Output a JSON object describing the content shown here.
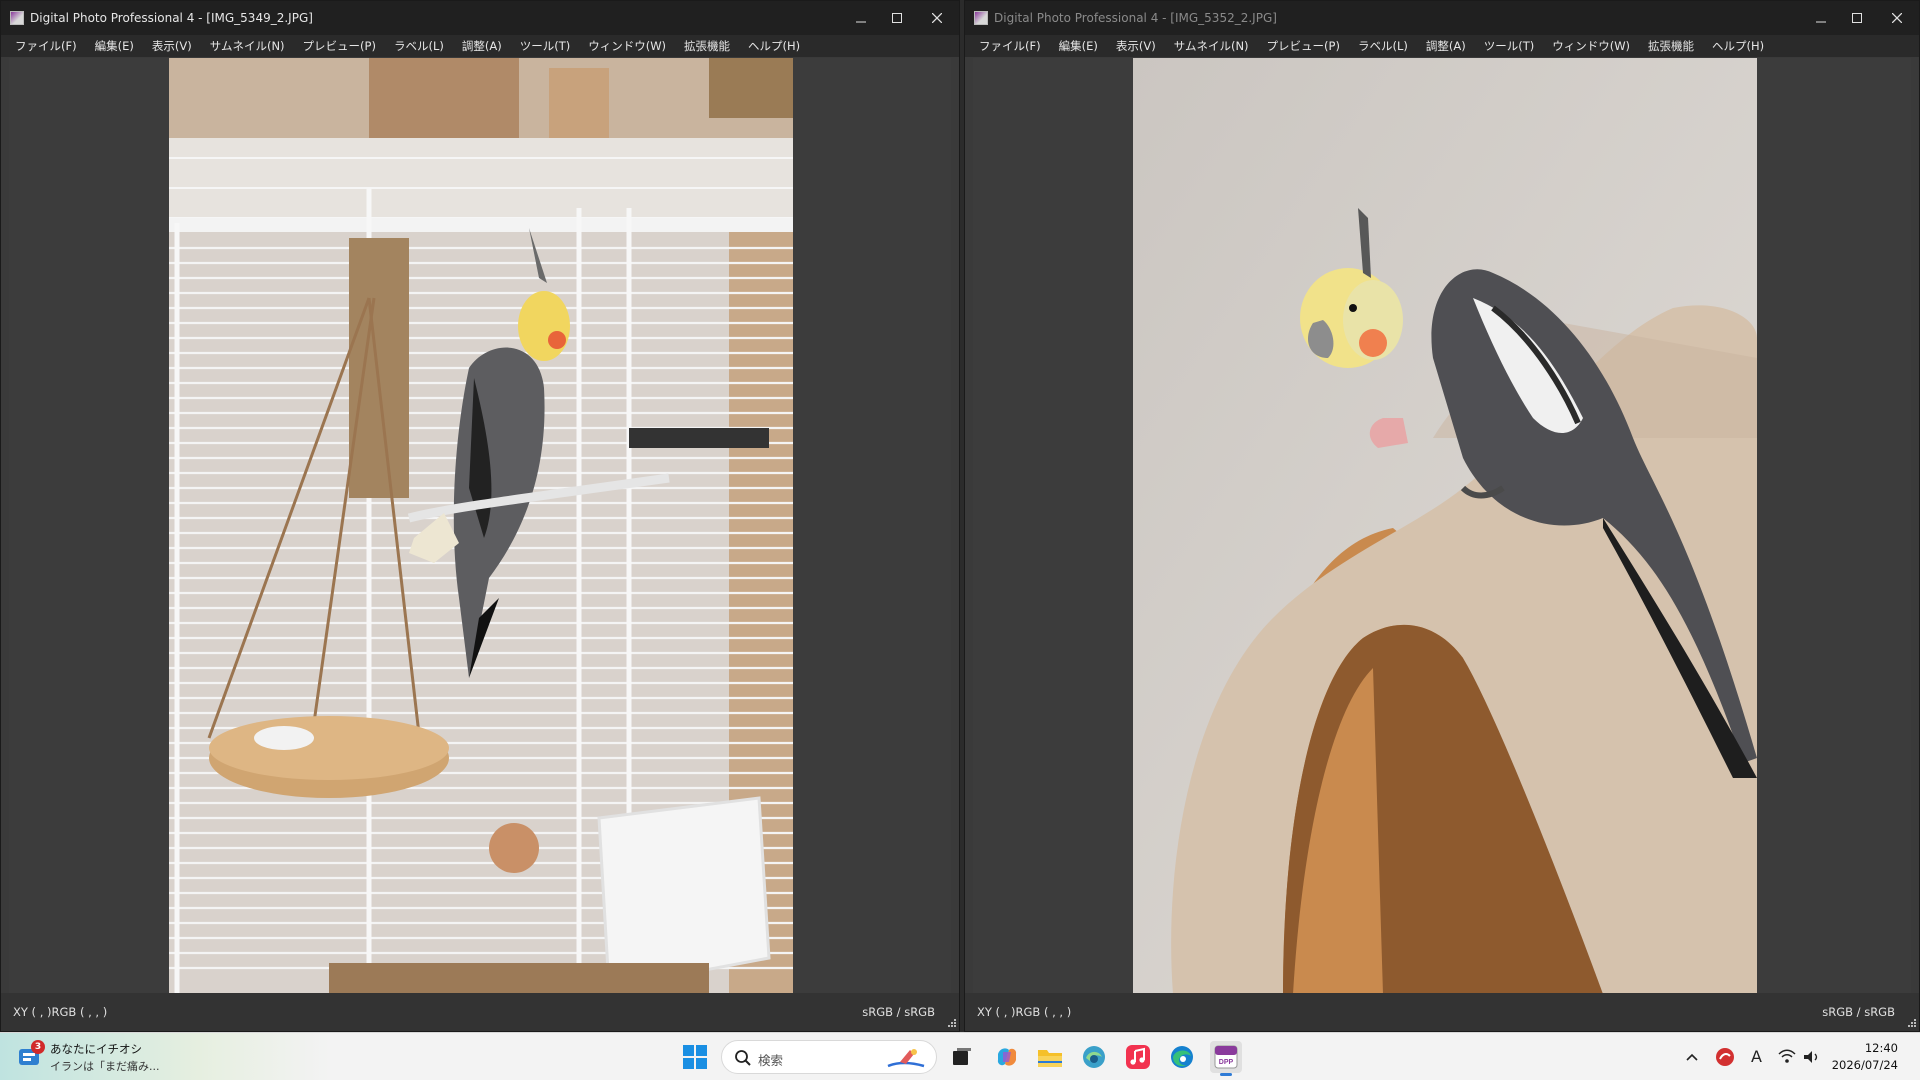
{
  "windows": [
    {
      "title": "Digital Photo Professional 4 - [IMG_5349_2.JPG]",
      "menu": [
        "ファイル(F)",
        "編集(E)",
        "表示(V)",
        "サムネイル(N)",
        "プレビュー(P)",
        "ラベル(L)",
        "調整(A)",
        "ツール(T)",
        "ウィンドウ(W)",
        "拡張機能",
        "ヘルプ(H)"
      ],
      "status_left": "XY (    ,    )RGB (    ,    ,    )",
      "status_right": "sRGB / sRGB"
    },
    {
      "title": "Digital Photo Professional 4 - [IMG_5352_2.JPG]",
      "menu": [
        "ファイル(F)",
        "編集(E)",
        "表示(V)",
        "サムネイル(N)",
        "プレビュー(P)",
        "ラベル(L)",
        "調整(A)",
        "ツール(T)",
        "ウィンドウ(W)",
        "拡張機能",
        "ヘルプ(H)"
      ],
      "status_left": "XY (    ,    )RGB (    ,    ,    )",
      "status_right": "sRGB / sRGB"
    }
  ],
  "taskbar": {
    "news_badge": "3",
    "news_title": "あなたにイチオシ",
    "news_sub": "イランは「まだ痛み...",
    "search_placeholder": "検索",
    "app_icons": [
      "task-view-icon",
      "copilot-icon",
      "file-explorer-icon",
      "edge-dev-icon",
      "music-icon",
      "edge-icon",
      "dpp-icon"
    ],
    "active_app": "dpp-icon",
    "dpp_label": "DPP",
    "ime_label": "A",
    "clock_time": "12:40",
    "clock_date": "2026/07/24"
  },
  "colors": {
    "taskbar_accent": "#2f7bd6",
    "news_badge": "#d12a2a",
    "security_icon": "#d23030"
  }
}
